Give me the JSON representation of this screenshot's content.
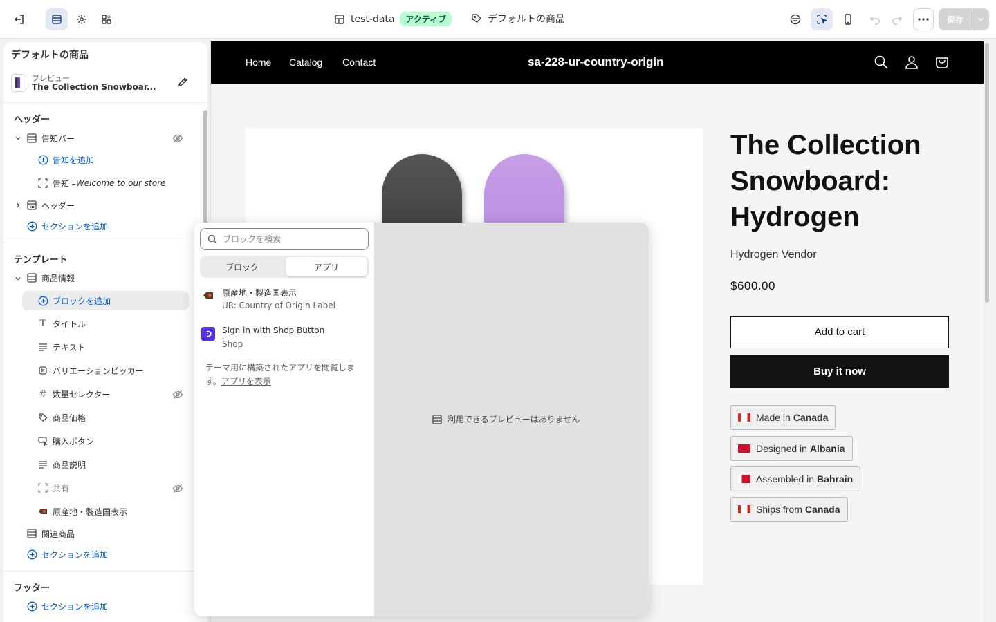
{
  "topbar": {
    "theme_name": "test-data",
    "theme_status": "アクティブ",
    "template_name": "デフォルトの商品",
    "save_label": "保存"
  },
  "sidebar": {
    "title": "デフォルトの商品",
    "preview_label": "プレビュー",
    "preview_product": "The Collection Snowboar...",
    "header_group": "ヘッダー",
    "header_items": {
      "announcement_bar": "告知バー",
      "add_announcement": "告知を追加",
      "announcement_prefix": "告知 – ",
      "announcement_text": "Welcome to our store",
      "header": "ヘッダー",
      "add_section": "セクションを追加"
    },
    "template_group": "テンプレート",
    "template_items": {
      "product_info": "商品情報",
      "add_block": "ブロックを追加",
      "title": "タイトル",
      "text": "テキスト",
      "variant_picker": "バリエーションピッカー",
      "quantity_selector": "数量セレクター",
      "price": "商品価格",
      "buy_buttons": "購入ボタン",
      "description": "商品説明",
      "share": "共有",
      "origin_block": "原産地・製造国表示",
      "related_products": "関連商品",
      "add_section": "セクションを追加"
    },
    "footer_group": "フッター",
    "footer_add_section": "セクションを追加"
  },
  "picker": {
    "search_placeholder": "ブロックを検索",
    "tab_blocks": "ブロック",
    "tab_apps": "アプリ",
    "apps": [
      {
        "name": "原産地・製造国表示",
        "vendor": "UR: Country of Origin Label",
        "icon": "tag-icon"
      },
      {
        "name": "Sign in with Shop Button",
        "vendor": "Shop",
        "icon": "shop-icon"
      }
    ],
    "browse_text": "テーマ用に構築されたアプリを閲覧します。",
    "browse_link": "アプリを表示",
    "no_preview": "利用できるプレビューはありません"
  },
  "store": {
    "nav": [
      "Home",
      "Catalog",
      "Contact"
    ],
    "store_name": "sa-228-ur-country-origin",
    "product_title": "The Collection Snowboard: Hydrogen",
    "vendor": "Hydrogen Vendor",
    "price": "$600.00",
    "add_to_cart": "Add to cart",
    "buy_now": "Buy it now",
    "origins": [
      {
        "prefix": "Made in",
        "country": "Canada",
        "flag_color": "#d52b1e"
      },
      {
        "prefix": "Designed in",
        "country": "Albania",
        "flag_color": "#c8102e"
      },
      {
        "prefix": "Assembled in",
        "country": "Bahrain",
        "flag_color": "#ce1126"
      },
      {
        "prefix": "Ships from",
        "country": "Canada",
        "flag_color": "#d52b1e"
      }
    ]
  }
}
